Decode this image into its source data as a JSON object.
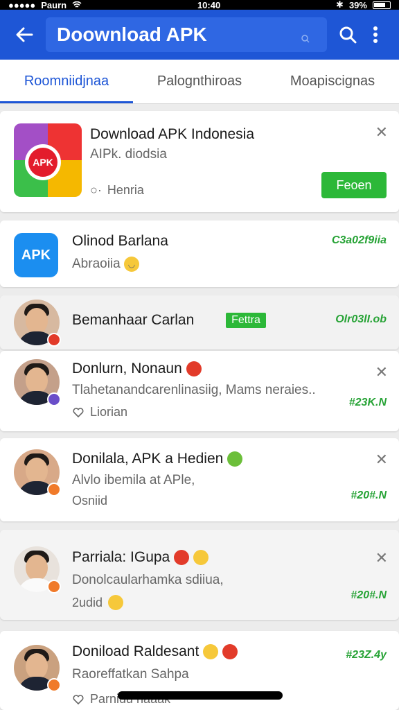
{
  "status_bar": {
    "carrier": "Paurn",
    "time": "10:40",
    "battery": "39%"
  },
  "app_bar": {
    "title": "Doownload APK"
  },
  "tabs": [
    "Roomniidjnaa",
    "Palognthiroas",
    "Moapiscignas"
  ],
  "cards": [
    {
      "title": "Download APK Indonesia",
      "subtitle": "AIPk. diodsia",
      "meta": "Henria",
      "button": "Feoen"
    },
    {
      "title": "Olinod Barlana",
      "subtitle": "Abraoiia",
      "stamp": "C3a02f9iia"
    },
    {
      "title": "Bemanhaar Carlan",
      "tag": "Fettra",
      "stamp": "Olr03lI.ob"
    },
    {
      "title": "Donlurn, Nonaun",
      "subtitle": "Tlahetanandcarenlinasiig, Mams neraies..",
      "meta": "Liorian",
      "stamp": "#23K.N"
    },
    {
      "title": "Donilala, APK a Hedien",
      "subtitle": "Alvlo ibemila at APle,",
      "meta": "Osniid",
      "stamp": "#20#.N"
    },
    {
      "title": "Parriala: IGupa",
      "subtitle": "Donolcaularhamka sdiiua,",
      "meta": "2udid",
      "stamp": "#20#.N"
    },
    {
      "title": "Doniload Raldesant",
      "subtitle": "Raoreffatkan Sahpa",
      "meta": "Parnidu haaak",
      "stamp": "#23Z.4y"
    }
  ],
  "colors": {
    "primary": "#1e56d6",
    "accent_green": "#2cb838",
    "stamp_green": "#27a336"
  }
}
